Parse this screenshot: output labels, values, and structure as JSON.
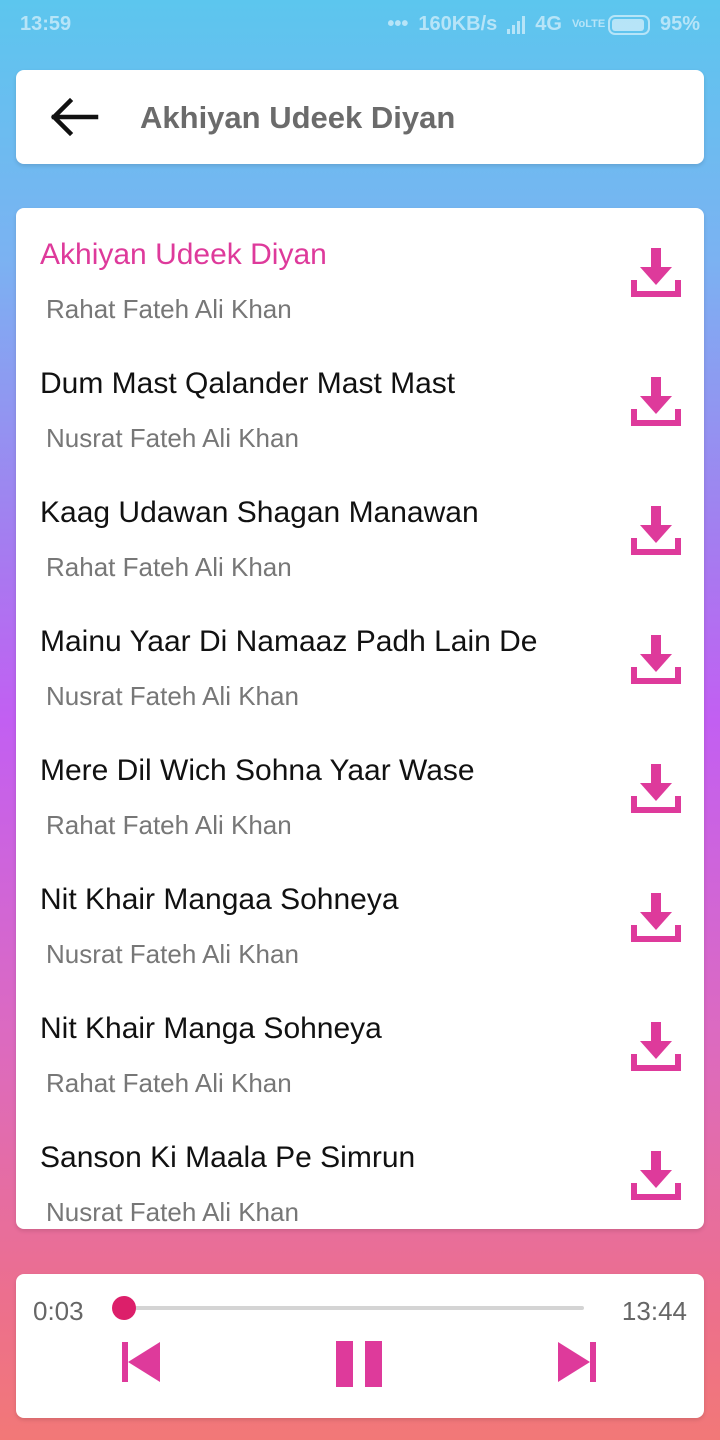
{
  "status_bar": {
    "time": "13:59",
    "dots": "•••",
    "net_speed": "160KB/s",
    "network": "4G",
    "volte": "VoLTE",
    "battery": "95%",
    "battery_level": 0.95
  },
  "header": {
    "back_icon": "arrow-left-icon",
    "title": "Akhiyan Udeek Diyan"
  },
  "songs": [
    {
      "title": "Akhiyan Udeek Diyan",
      "artist": "Rahat Fateh Ali Khan",
      "active": true
    },
    {
      "title": "Dum Mast Qalander Mast Mast",
      "artist": "Nusrat Fateh Ali Khan",
      "active": false
    },
    {
      "title": "Kaag Udawan Shagan Manawan",
      "artist": "Rahat Fateh Ali Khan",
      "active": false
    },
    {
      "title": "Mainu Yaar Di Namaaz Padh Lain De",
      "artist": "Nusrat Fateh Ali Khan",
      "active": false
    },
    {
      "title": "Mere Dil Wich Sohna Yaar Wase",
      "artist": "Rahat Fateh Ali Khan",
      "active": false
    },
    {
      "title": "Nit Khair Mangaa Sohneya",
      "artist": "Nusrat Fateh Ali Khan",
      "active": false
    },
    {
      "title": "Nit Khair Manga Sohneya",
      "artist": "Rahat Fateh Ali Khan",
      "active": false
    },
    {
      "title": "Sanson Ki Maala Pe Simrun",
      "artist": "Nusrat Fateh Ali Khan",
      "active": false
    }
  ],
  "player": {
    "current_time": "0:03",
    "total_time": "13:44",
    "progress": 0.004,
    "prev_icon": "skip-previous-icon",
    "pause_icon": "pause-icon",
    "next_icon": "skip-next-icon"
  },
  "colors": {
    "accent": "#de3a9b",
    "progress": "#dc1f6a",
    "title_text": "#111111",
    "artist_text": "#777777"
  }
}
